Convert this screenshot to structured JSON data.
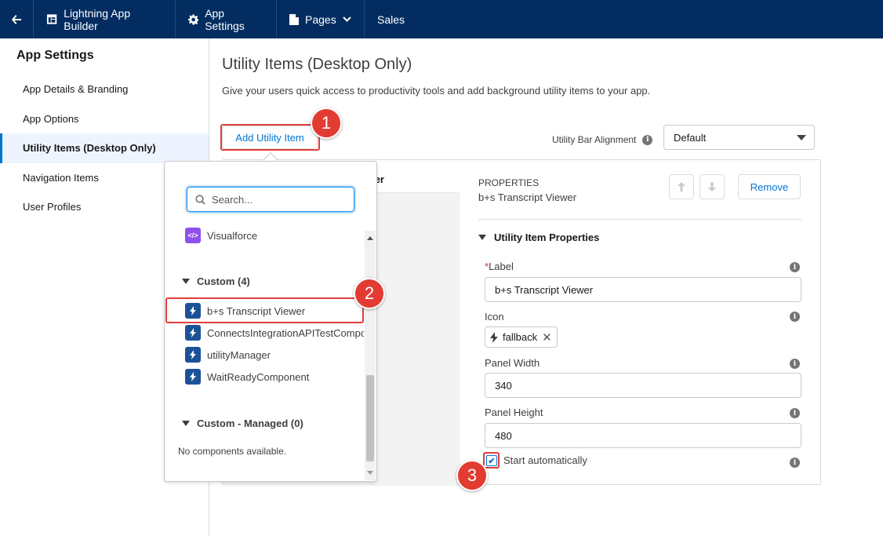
{
  "topbar": {
    "builder_label": "Lightning App Builder",
    "app_settings_label": "App Settings",
    "pages_label": "Pages",
    "app_name": "Sales"
  },
  "sidebar": {
    "title": "App Settings",
    "items": [
      {
        "label": "App Details & Branding"
      },
      {
        "label": "App Options"
      },
      {
        "label": "Utility Items (Desktop Only)",
        "active": true
      },
      {
        "label": "Navigation Items"
      },
      {
        "label": "User Profiles"
      }
    ]
  },
  "main": {
    "title": "Utility Items (Desktop Only)",
    "description": "Give your users quick access to productivity tools and add background utility items to your app.",
    "add_button": "Add Utility Item",
    "alignment_label": "Utility Bar Alignment",
    "alignment_value": "Default",
    "list_header_visible": "er"
  },
  "properties": {
    "caption": "PROPERTIES",
    "item_name": "b+s Transcript Viewer",
    "remove_button": "Remove",
    "section_title": "Utility Item Properties",
    "label_field": {
      "label": "Label",
      "required_mark": "*",
      "value": "b+s Transcript Viewer"
    },
    "icon_field": {
      "label": "Icon",
      "value": "fallback"
    },
    "panel_width": {
      "label": "Panel Width",
      "value": "340"
    },
    "panel_height": {
      "label": "Panel Height",
      "value": "480"
    },
    "start_automatically": {
      "label": "Start automatically",
      "checked": true
    }
  },
  "dropdown": {
    "search_placeholder": "Search...",
    "partial_item": "Visualforce",
    "custom_group": "Custom (4)",
    "custom_items": [
      {
        "label": "b+s Transcript Viewer"
      },
      {
        "label": "ConnectsIntegrationAPITestComponent"
      },
      {
        "label": "utilityManager"
      },
      {
        "label": "WaitReadyComponent"
      }
    ],
    "managed_group": "Custom - Managed (0)",
    "managed_empty": "No components available."
  },
  "badges": [
    "1",
    "2",
    "3"
  ],
  "colors": {
    "topbar": "#032d60",
    "brand_blue": "#0176d3",
    "highlight_red": "#e03c3c",
    "badge_red": "#e23b32",
    "active_nav_bg": "#eef4ff"
  }
}
